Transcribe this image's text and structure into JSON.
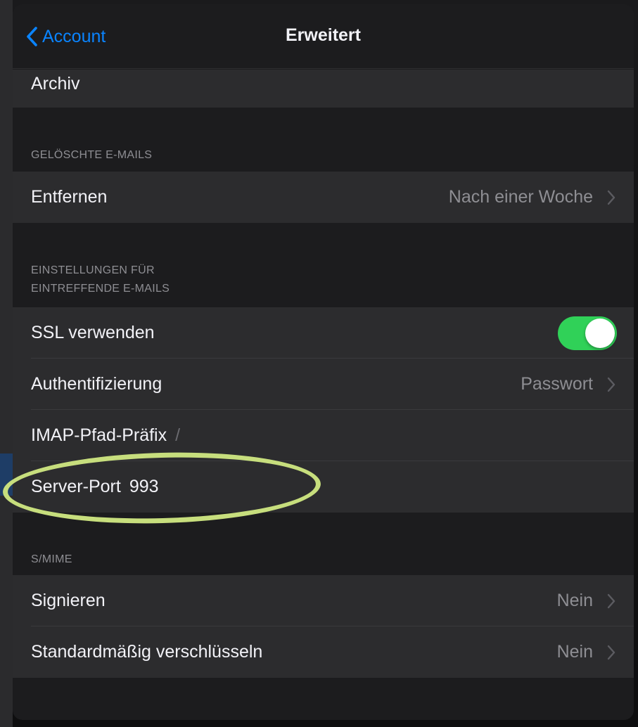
{
  "nav": {
    "back_label": "Account",
    "title": "Erweitert"
  },
  "rows": {
    "archiv": {
      "label": "Archiv"
    },
    "entfernen": {
      "label": "Entfernen",
      "value": "Nach einer Woche"
    },
    "ssl": {
      "label": "SSL verwenden",
      "enabled": true
    },
    "auth": {
      "label": "Authentifizierung",
      "value": "Passwort"
    },
    "imap": {
      "label": "IMAP-Pfad-Präfix",
      "value": "/"
    },
    "port": {
      "label": "Server-Port",
      "value": "993"
    },
    "signieren": {
      "label": "Signieren",
      "value": "Nein"
    },
    "verschluesseln": {
      "label": "Standardmäßig verschlüsseln",
      "value": "Nein"
    }
  },
  "sections": {
    "deleted_header": "GELÖSCHTE E-MAILS",
    "incoming_header_line1": "EINSTELLUNGEN FÜR",
    "incoming_header_line2": "EINTREFFENDE E-MAILS",
    "smime_header": "S/MIME"
  },
  "colors": {
    "accent": "#0a84ff",
    "toggle_on": "#30d158",
    "highlight_ring": "#c7de7d"
  }
}
